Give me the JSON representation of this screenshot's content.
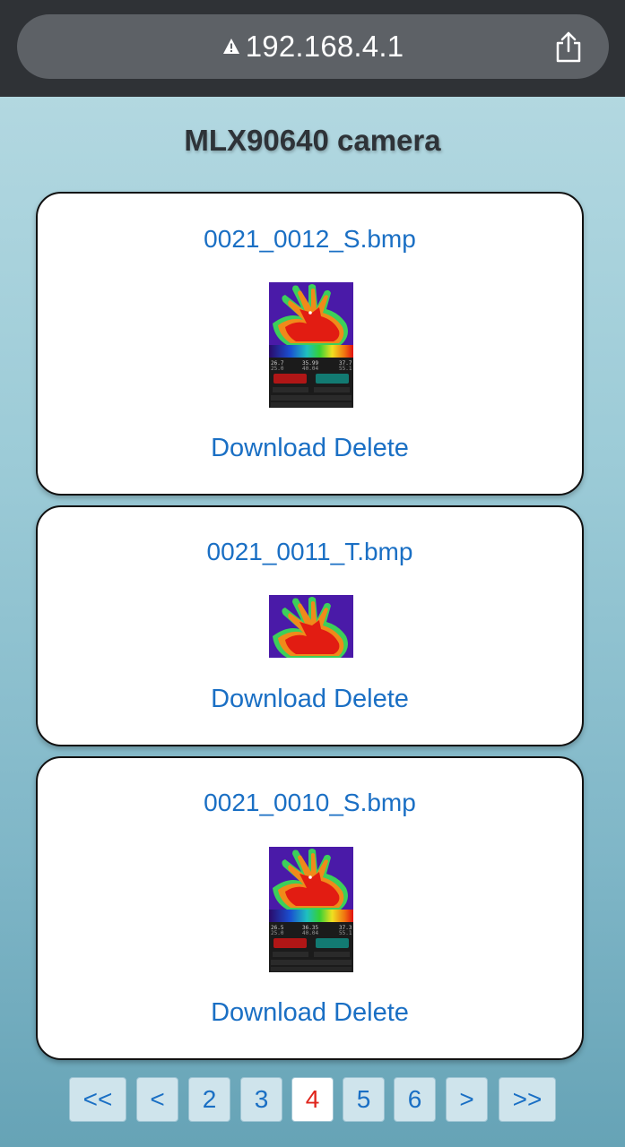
{
  "browser": {
    "url": "192.168.4.1",
    "warning_icon": "warning-triangle-icon",
    "share_icon": "share-icon"
  },
  "page": {
    "title": "MLX90640 camera"
  },
  "files": [
    {
      "name": "0021_0012_S.bmp",
      "type": "screenshot",
      "download_label": "Download",
      "delete_label": "Delete",
      "readings": {
        "min": "26.7",
        "center": "35.99",
        "max": "37.7",
        "low2": "25.0",
        "mid2": "40.04",
        "high2": "55.1"
      }
    },
    {
      "name": "0021_0011_T.bmp",
      "type": "thermal",
      "download_label": "Download",
      "delete_label": "Delete"
    },
    {
      "name": "0021_0010_S.bmp",
      "type": "screenshot",
      "download_label": "Download",
      "delete_label": "Delete",
      "readings": {
        "min": "26.5",
        "center": "36.35",
        "max": "37.3",
        "low2": "25.0",
        "mid2": "40.04",
        "high2": "55.1"
      }
    }
  ],
  "pagination": {
    "first": "<<",
    "prev": "<",
    "pages": [
      "2",
      "3",
      "4",
      "5",
      "6"
    ],
    "current": "4",
    "next": ">",
    "last": ">>"
  },
  "colors": {
    "link": "#1a6fc4",
    "active_page": "#e0251c",
    "topbar": "#2f3236"
  }
}
